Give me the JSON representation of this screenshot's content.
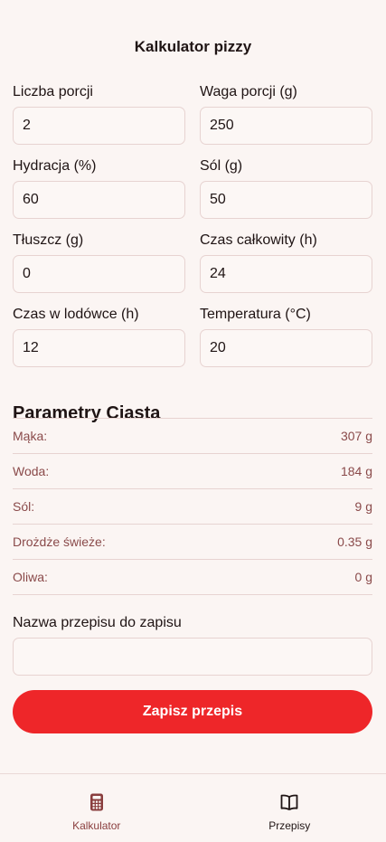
{
  "header": {
    "title": "Kalkulator pizzy"
  },
  "form": {
    "fields": [
      {
        "label": "Liczba porcji",
        "value": "2"
      },
      {
        "label": "Waga porcji (g)",
        "value": "250"
      },
      {
        "label": "Hydracja (%)",
        "value": "60"
      },
      {
        "label": "Sól (g)",
        "value": "50"
      },
      {
        "label": "Tłuszcz (g)",
        "value": "0"
      },
      {
        "label": "Czas całkowity (h)",
        "value": "24"
      },
      {
        "label": "Czas w lodówce (h)",
        "value": "12"
      },
      {
        "label": "Temperatura (°C)",
        "value": "20"
      }
    ]
  },
  "params": {
    "title": "Parametry Ciasta",
    "rows": [
      {
        "label": "Mąka:",
        "value": "307 g"
      },
      {
        "label": "Woda:",
        "value": "184 g"
      },
      {
        "label": "Sól:",
        "value": "9 g"
      },
      {
        "label": "Drożdże świeże:",
        "value": "0.35 g"
      },
      {
        "label": "Oliwa:",
        "value": "0 g"
      }
    ]
  },
  "save": {
    "label": "Nazwa przepisu do zapisu",
    "value": "",
    "placeholder": "",
    "button_label": "Zapisz przepis"
  },
  "nav": {
    "items": [
      {
        "label": "Kalkulator",
        "icon": "calculator-icon",
        "active": true
      },
      {
        "label": "Przepisy",
        "icon": "book-icon",
        "active": false
      }
    ]
  },
  "colors": {
    "background": "#fbf5f3",
    "accent": "#ee2629",
    "param_text": "#8a4a4a",
    "nav_active": "#8a3e3e"
  }
}
